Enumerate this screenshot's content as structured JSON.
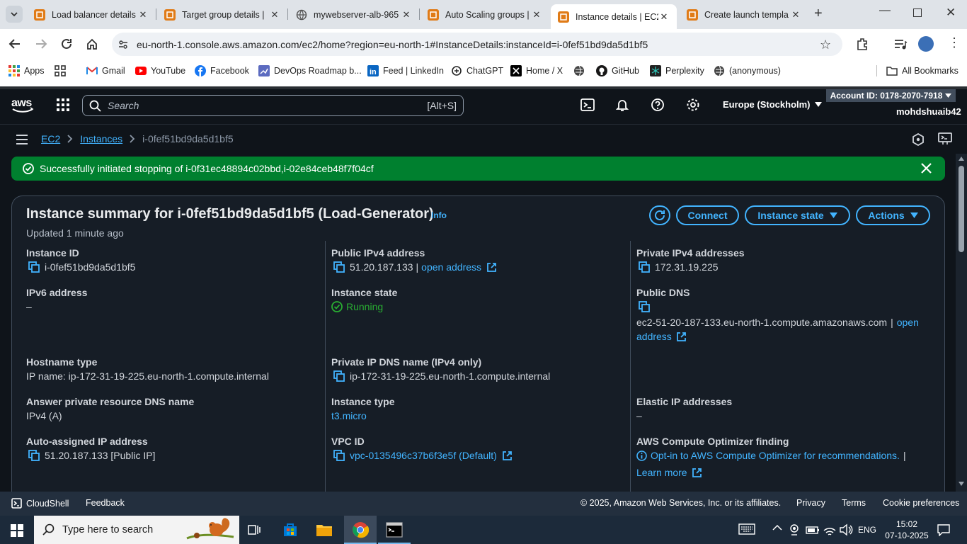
{
  "browser": {
    "tabs": [
      {
        "title": "Load balancer details",
        "icon": "aws-ec2-icon"
      },
      {
        "title": "Target group details |",
        "icon": "aws-ec2-icon"
      },
      {
        "title": "mywebserver-alb-965",
        "icon": "globe-icon"
      },
      {
        "title": "Auto Scaling groups |",
        "icon": "aws-ec2-icon"
      },
      {
        "title": "Instance details | EC2",
        "icon": "aws-ec2-icon",
        "active": true
      },
      {
        "title": "Create launch templa",
        "icon": "aws-ec2-icon"
      }
    ],
    "url": "eu-north-1.console.aws.amazon.com/ec2/home?region=eu-north-1#InstanceDetails:instanceId=i-0fef51bd9da5d1bf5",
    "bookmarks": [
      {
        "label": "Apps",
        "icon": "apps-grid-icon"
      },
      {
        "label": "",
        "icon": "grid-icon"
      },
      {
        "label": "Gmail",
        "icon": "gmail-icon"
      },
      {
        "label": "YouTube",
        "icon": "youtube-icon"
      },
      {
        "label": "Facebook",
        "icon": "facebook-icon"
      },
      {
        "label": "DevOps Roadmap b...",
        "icon": "roadmap-icon"
      },
      {
        "label": "Feed | LinkedIn",
        "icon": "linkedin-icon"
      },
      {
        "label": "ChatGPT",
        "icon": "chatgpt-icon"
      },
      {
        "label": "Home / X",
        "icon": "x-icon"
      },
      {
        "label": "",
        "icon": "globe-icon"
      },
      {
        "label": "GitHub",
        "icon": "github-icon"
      },
      {
        "label": "Perplexity",
        "icon": "perplexity-icon"
      },
      {
        "label": "(anonymous)",
        "icon": "globe-icon"
      }
    ],
    "all_bookmarks": "All Bookmarks"
  },
  "aws": {
    "search_placeholder": "Search",
    "search_shortcut": "[Alt+S]",
    "region": "Europe (Stockholm)",
    "account_id": "Account ID: 0178-2070-7918",
    "username": "mohdshuaib42",
    "breadcrumb": [
      "EC2",
      "Instances",
      "i-0fef51bd9da5d1bf5"
    ],
    "flash": "Successfully initiated stopping of i-0f31ec48894c02bbd,i-02e84ceb48f7f04cf"
  },
  "summary": {
    "title": "Instance summary for i-0fef51bd9da5d1bf5 (Load-Generator)",
    "info": "Info",
    "updated": "Updated 1 minute ago",
    "connect": "Connect",
    "instance_state_btn": "Instance state",
    "actions": "Actions",
    "fields": {
      "instance_id": {
        "label": "Instance ID",
        "value": "i-0fef51bd9da5d1bf5"
      },
      "public_ipv4": {
        "label": "Public IPv4 address",
        "value": "51.20.187.133",
        "sep": "|",
        "link": "open address"
      },
      "private_ipv4": {
        "label": "Private IPv4 addresses",
        "value": "172.31.19.225"
      },
      "ipv6": {
        "label": "IPv6 address",
        "value": "–"
      },
      "instance_state": {
        "label": "Instance state",
        "value": "Running"
      },
      "public_dns": {
        "label": "Public DNS",
        "value": "ec2-51-20-187-133.eu-north-1.compute.amazonaws.com",
        "sep": "|",
        "link1": "open",
        "link2": "address"
      },
      "hostname_type": {
        "label": "Hostname type",
        "value": "IP name: ip-172-31-19-225.eu-north-1.compute.internal"
      },
      "private_dns": {
        "label": "Private IP DNS name (IPv4 only)",
        "value": "ip-172-31-19-225.eu-north-1.compute.internal"
      },
      "answer_dns": {
        "label": "Answer private resource DNS name",
        "value": "IPv4 (A)"
      },
      "instance_type": {
        "label": "Instance type",
        "value": "t3.micro"
      },
      "elastic_ip": {
        "label": "Elastic IP addresses",
        "value": "–"
      },
      "auto_ip": {
        "label": "Auto-assigned IP address",
        "value": "51.20.187.133 [Public IP]"
      },
      "vpc": {
        "label": "VPC ID",
        "value": "vpc-0135496c37b6f3e5f (Default)"
      },
      "optimizer": {
        "label": "AWS Compute Optimizer finding",
        "value": "Opt-in to AWS Compute Optimizer for recommendations.",
        "sep": "|",
        "link": "Learn more"
      }
    }
  },
  "footer": {
    "cloudshell": "CloudShell",
    "feedback": "Feedback",
    "copyright": "© 2025, Amazon Web Services, Inc. or its affiliates.",
    "privacy": "Privacy",
    "terms": "Terms",
    "cookies": "Cookie preferences"
  },
  "taskbar": {
    "search_placeholder": "Type here to search",
    "lang": "ENG",
    "time": "15:02",
    "date": "07-10-2025"
  },
  "colors": {
    "aws_bg": "#0f141a",
    "panel_bg": "#161d26",
    "link": "#42b4ff",
    "success": "#00802f",
    "running": "#29ad32"
  }
}
